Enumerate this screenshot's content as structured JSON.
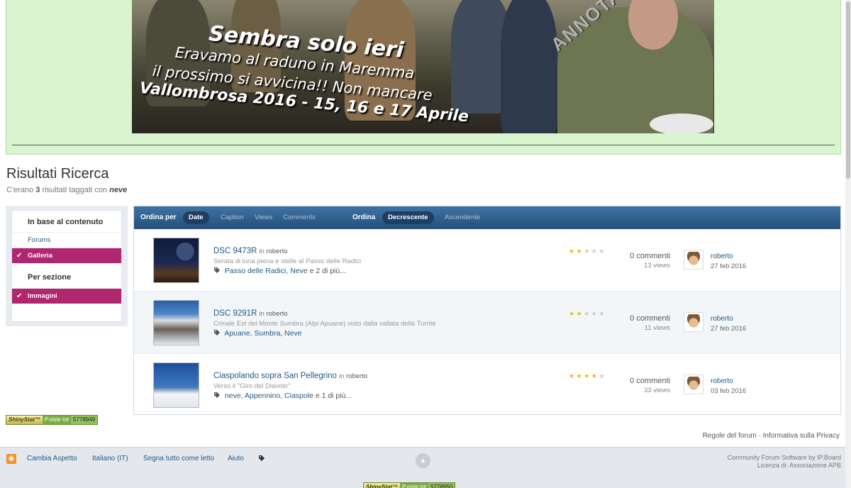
{
  "banner": {
    "line1": "Sembra solo ieri",
    "line2": "Eravamo al raduno in Maremma",
    "line3": "il prossimo si avvicina!! Non mancare",
    "line4": "Vallombrosa 2016 - 15, 16 e 17 Aprile",
    "stamp": "ANNOTA LA DATA!"
  },
  "page": {
    "title": "Risultati Ricerca",
    "desc_prefix": "C'erano",
    "desc_count": "3",
    "desc_middle": "risultati taggati con",
    "desc_tag": "neve"
  },
  "sidebar": {
    "section1": "In base al contenuto",
    "items1": [
      "Forums",
      "Galleria"
    ],
    "section2": "Per sezione",
    "items2": [
      "Immagini"
    ]
  },
  "sortbar": {
    "order_by": "Ordina per",
    "order_by_active": "Date",
    "order_by_options": [
      "Caption",
      "Views",
      "Comments"
    ],
    "order": "Ordina",
    "order_active": "Decrescente",
    "order_option": "Ascendente"
  },
  "results": [
    {
      "title": "DSC 9473R",
      "in_label": "in",
      "author": "roberto",
      "desc": "Serata di luna piena e stelle al Passo delle Radici",
      "tags": [
        "Passo delle Radici",
        "Neve"
      ],
      "tags_more": "e 2 di più...",
      "rating": 2,
      "comments": "0 commenti",
      "views": "13 views",
      "user": "roberto",
      "date": "27 feb 2016"
    },
    {
      "title": "DSC 9291R",
      "in_label": "in",
      "author": "roberto",
      "desc": "Crinale Est del Monte Sumbra (Alpi Apuane) visto dalla vallata della Turrite",
      "tags": [
        "Apuane",
        "Sumbra",
        "Neve"
      ],
      "tags_more": "",
      "rating": 2,
      "comments": "0 commenti",
      "views": "11 views",
      "user": "roberto",
      "date": "27 feb 2016"
    },
    {
      "title": "Ciaspolando sopra San Pellegrino",
      "in_label": "in",
      "author": "roberto",
      "desc": "Verso il \"Giro del Diavolo\"",
      "tags": [
        "neve",
        "Appennino",
        "Ciaspole"
      ],
      "tags_more": "e 1 di più...",
      "rating": 4,
      "comments": "0 commenti",
      "views": "33 views",
      "user": "roberto",
      "date": "03 feb 2016"
    }
  ],
  "shinystat": {
    "brand": "ShinyStat™",
    "label": "P.viste tot",
    "count1": "5778949",
    "count2": "5778950"
  },
  "footlinks": {
    "rules": "Regole del forum",
    "sep": "·",
    "privacy": "Informativa sulla Privacy"
  },
  "footer": {
    "links": [
      "Cambia Aspetto",
      "Italiano (IT)",
      "Segna tutto come letto",
      "Aiuto"
    ],
    "copy1": "Community Forum Software by IP.Board",
    "copy2": "Licenza di: Associazione APB"
  },
  "colors": {
    "header_bg": "#d9f5d0",
    "accent": "#b0266f",
    "bar": "#2f5f8f",
    "star": "#f5b700"
  }
}
